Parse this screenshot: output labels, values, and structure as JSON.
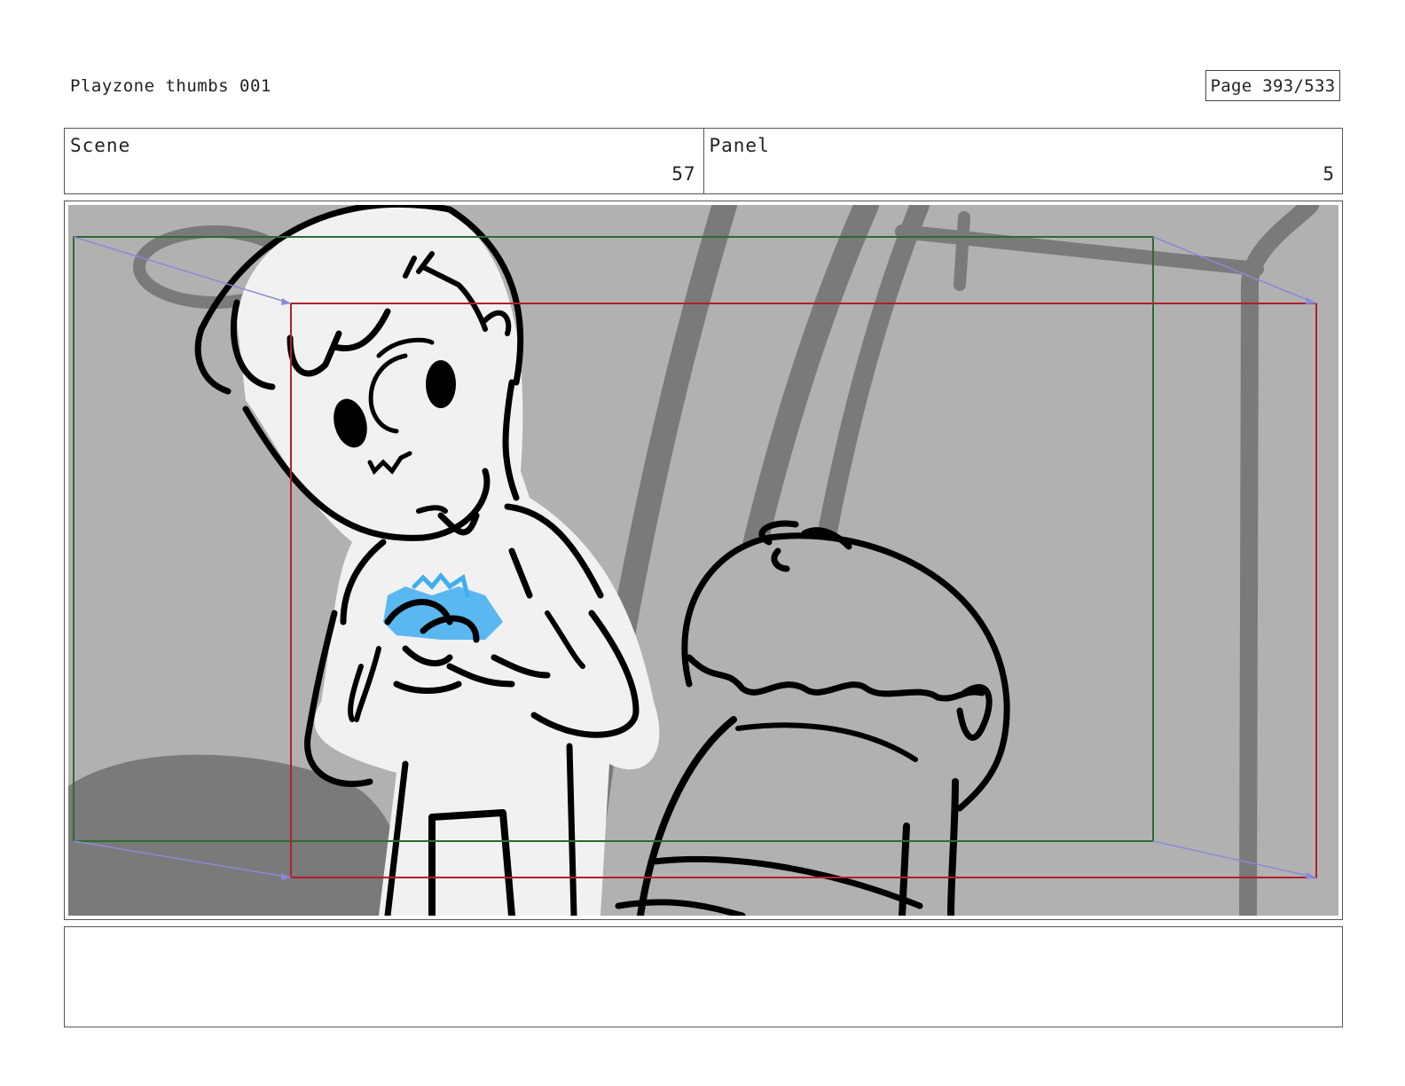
{
  "header": {
    "title": "Playzone thumbs 001",
    "page_label": "Page 393/533"
  },
  "info": {
    "scene_label": "Scene",
    "scene_value": "57",
    "panel_label": "Panel",
    "panel_value": "5"
  },
  "frame": {
    "colors": {
      "background": "#b1b1b1",
      "character_fill": "#f1f1f1",
      "dark_shape": "#7a7a7a",
      "ink": "#000000",
      "highlight_blue": "#41adf0",
      "start_camera_box": "#2e6b2e",
      "end_camera_box": "#b0202a",
      "motion_arrow": "#8a8ad8"
    }
  },
  "notes": {
    "text": ""
  }
}
